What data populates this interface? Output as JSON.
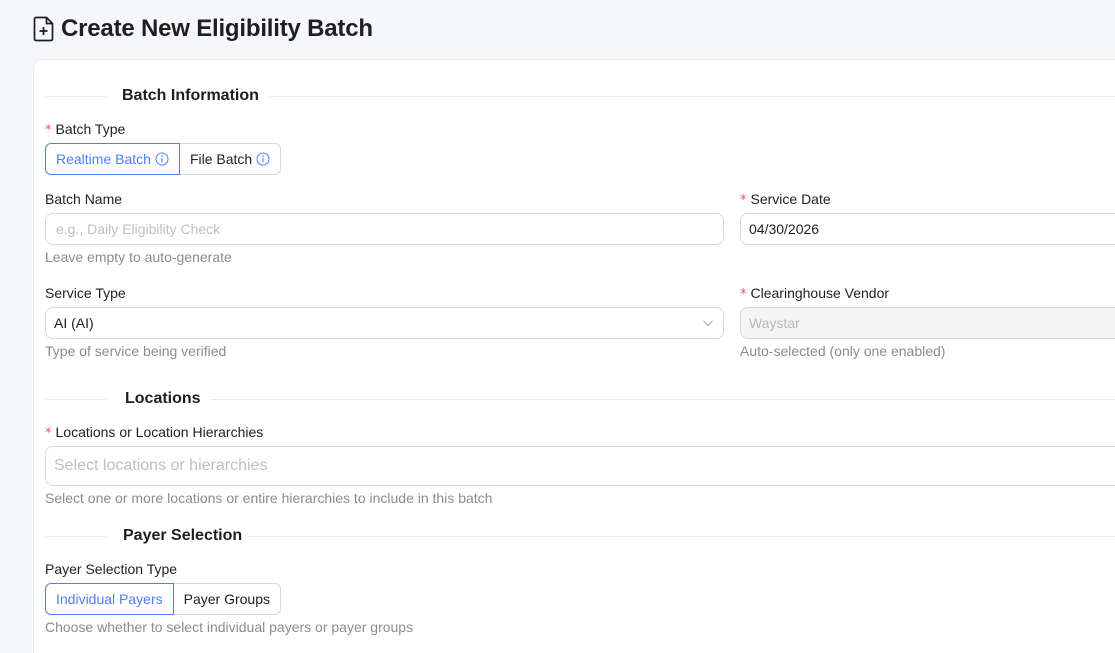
{
  "page": {
    "title": "Create New Eligibility Batch"
  },
  "batch_info": {
    "section_title": "Batch Information",
    "batch_type": {
      "label": "Batch Type",
      "required": "*",
      "options": [
        "Realtime Batch",
        "File Batch"
      ],
      "selected": "Realtime Batch"
    },
    "batch_name": {
      "label": "Batch Name",
      "placeholder": "e.g., Daily Eligibility Check",
      "value": "",
      "help": "Leave empty to auto-generate"
    },
    "service_date": {
      "label": "Service Date",
      "required": "*",
      "value": "04/30/2026"
    },
    "service_type": {
      "label": "Service Type",
      "value": "AI (AI)",
      "help": "Type of service being verified"
    },
    "clearinghouse_vendor": {
      "label": "Clearinghouse Vendor",
      "required": "*",
      "value": "Waystar",
      "help": "Auto-selected (only one enabled)"
    }
  },
  "locations": {
    "section_title": "Locations",
    "field": {
      "label": "Locations or Location Hierarchies",
      "required": "*",
      "placeholder": "Select locations or hierarchies",
      "help": "Select one or more locations or entire hierarchies to include in this batch"
    }
  },
  "payer_selection": {
    "section_title": "Payer Selection",
    "type": {
      "label": "Payer Selection Type",
      "options": [
        "Individual Payers",
        "Payer Groups"
      ],
      "selected": "Individual Payers",
      "help": "Choose whether to select individual payers or payer groups"
    }
  },
  "colors": {
    "accent": "#4f7ef7",
    "required": "#ff4d4f",
    "help_text": "#8c8c8c",
    "border": "#d9d9d9"
  },
  "icons": [
    "file-plus-icon",
    "info-icon",
    "chevron-down-icon"
  ]
}
